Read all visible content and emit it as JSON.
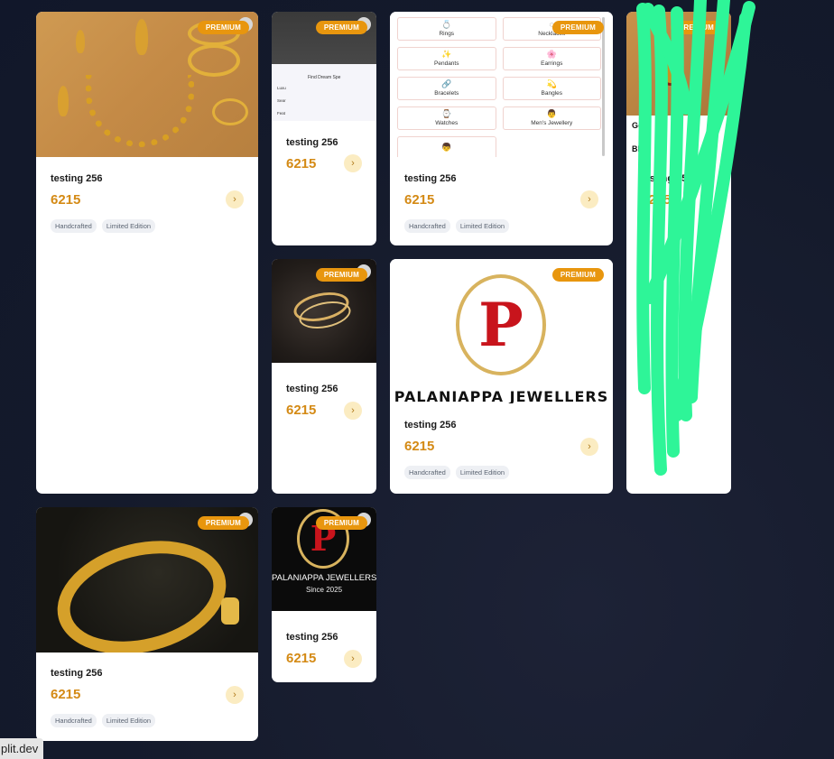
{
  "cards": [
    {
      "title": "testing 256",
      "price": "6215",
      "badge": "PREMIUM",
      "tags": [
        "Handcrafted",
        "Limited Edition"
      ]
    },
    {
      "title": "testing 256",
      "price": "6215",
      "badge": "PREMIUM"
    },
    {
      "title": "testing 256",
      "price": "6215",
      "badge": "PREMIUM",
      "tags": [
        "Handcrafted",
        "Limited Edition"
      ]
    },
    {
      "title": "testing 256",
      "price": "6215",
      "badge": "PREMIUM",
      "visible_title_fragment": "Go",
      "visible_sub_fragment": "BD"
    },
    {
      "title": "testing 256",
      "price": "6215",
      "badge": "PREMIUM"
    },
    {
      "title": "testing 256",
      "price": "6215",
      "badge": "PREMIUM",
      "tags": [
        "Handcrafted",
        "Limited Edition"
      ]
    },
    {
      "title": "testing 256",
      "price": "6215",
      "badge": "PREMIUM",
      "tags": [
        "Handcrafted",
        "Limited Edition"
      ]
    },
    {
      "title": "testing 256",
      "price": "6215",
      "badge": "PREMIUM"
    }
  ],
  "categories": [
    {
      "label": "Rings",
      "icon": "ring-icon",
      "glyph": "💍"
    },
    {
      "label": "Necklaces",
      "icon": "necklace-icon",
      "glyph": "◌"
    },
    {
      "label": "Pendants",
      "icon": "sparkle-icon",
      "glyph": "✨"
    },
    {
      "label": "Earrings",
      "icon": "flower-icon",
      "glyph": "🌸"
    },
    {
      "label": "Bracelets",
      "icon": "link-icon",
      "glyph": "🔗"
    },
    {
      "label": "Bangles",
      "icon": "crescent-icon",
      "glyph": "💫"
    },
    {
      "label": "Watches",
      "icon": "watch-icon",
      "glyph": "⌚"
    },
    {
      "label": "Men's Jewellery",
      "icon": "man-icon",
      "glyph": "👨"
    },
    {
      "label": "",
      "icon": "person-icon",
      "glyph": "👦"
    }
  ],
  "logo": {
    "letter": "P",
    "brand": "PALANIAPPA JEWELLERS",
    "since": "Since 2025"
  },
  "mini_screen": {
    "heading": "Find Dream Spe",
    "lines": [
      "Luxu",
      "Sear",
      "Feat"
    ]
  },
  "toast": "plit.dev",
  "colors": {
    "background": "#141a2b",
    "badge": "#e8960e",
    "price": "#d48a15",
    "scribble": "#2ef598",
    "logo_red": "#c8141c",
    "logo_gold": "#d8b35e"
  }
}
